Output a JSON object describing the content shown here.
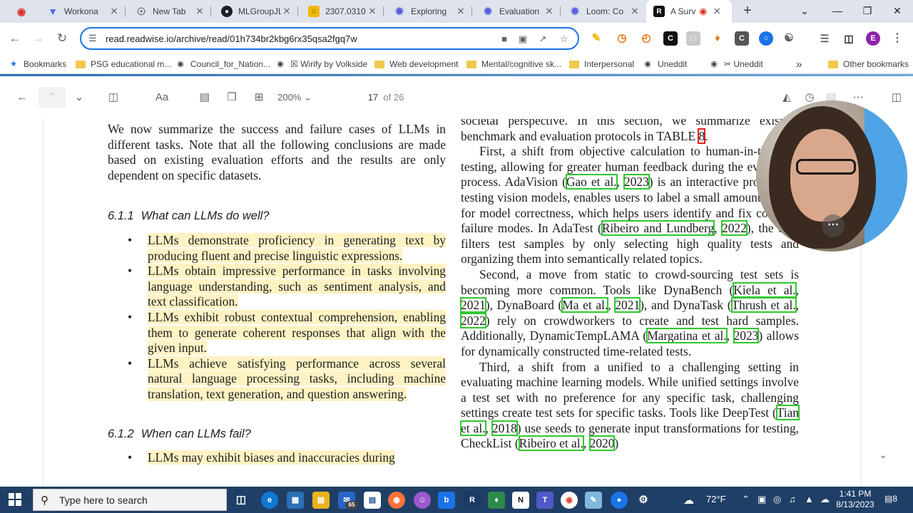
{
  "browser": {
    "tabs": [
      {
        "title": "",
        "icon": "record-icon",
        "color": "#d93025"
      },
      {
        "title": "Workona",
        "icon": "workona-icon",
        "color": "#4a6cf7"
      },
      {
        "title": "New Tab",
        "icon": "chrome-icon",
        "color": "#5f6368"
      },
      {
        "title": "MLGroupJL",
        "icon": "github-icon",
        "color": "#1b1f23"
      },
      {
        "title": "2307.0310",
        "icon": "smiley-icon",
        "color": "#f5b800"
      },
      {
        "title": "Exploring",
        "icon": "gear-icon",
        "color": "#5b5fe0"
      },
      {
        "title": "Evaluation",
        "icon": "gear-icon",
        "color": "#5b5fe0"
      },
      {
        "title": "Loom: Co",
        "icon": "loom-icon",
        "color": "#5b5fe0"
      },
      {
        "title": "A Surv",
        "icon": "readwise-icon",
        "color": "#111111"
      }
    ],
    "new_tab_label": "+",
    "url": "read.readwise.io/archive/read/01h734br2kbg6rx35qsa2fgq7w",
    "profile_initial": "E",
    "bookmarks": [
      {
        "label": "Bookmarks",
        "icon": "star"
      },
      {
        "label": "PSG educational m...",
        "icon": "folder"
      },
      {
        "label": "Council_for_Nation...",
        "icon": "globe"
      },
      {
        "label": "☒ Wirify by Volkside",
        "icon": "globe"
      },
      {
        "label": "Web development",
        "icon": "folder"
      },
      {
        "label": "Mental/cognitive sk...",
        "icon": "folder"
      },
      {
        "label": "Interpersonal",
        "icon": "folder"
      },
      {
        "label": "Uneddit",
        "icon": "globe"
      },
      {
        "label": "✂ Uneddit",
        "icon": "globe"
      }
    ],
    "bookmarks_overflow": "»",
    "other_bookmarks": "Other bookmarks"
  },
  "reader": {
    "zoom": "200%",
    "page_current": "17",
    "page_total": "of 26",
    "font_button": "Aa"
  },
  "document": {
    "left": {
      "intro": "We now summarize the success and failure cases of LLMs in different tasks. Note that all the following conclusions are made based on existing evaluation efforts and the results are only dependent on specific datasets.",
      "h1_num": "6.1.1",
      "h1_title": "What can LLMs do well?",
      "bullets": [
        "LLMs demonstrate proficiency in generating text by producing fluent and precise linguistic expressions.",
        "LLMs obtain impressive performance in tasks involving language understanding, such as sentiment analysis, and text classification.",
        "LLMs exhibit robust contextual comprehension, enabling them to generate coherent responses that align with the given input.",
        "LLMs achieve satisfying performance across several natural language processing tasks, including machine translation, text generation, and question answering."
      ],
      "h2_num": "6.1.2",
      "h2_title": "When can LLMs fail?",
      "bullet_fail": "LLMs may exhibit biases and inaccuracies during"
    },
    "right": {
      "p0_a": "societal perspective. In this section, we summarize existing benchmark and evaluation protocols in TABLE ",
      "p0_ref": "8",
      "p0_b": ".",
      "p1_a": "First, a shift from objective calculation to human-in-the-loop testing, allowing for greater human feedback during the evaluation process. AdaVision (",
      "p1_c1": "Gao et al.",
      "p1_c1y": "2023",
      "p1_b": ") is an interactive process for testing vision models, enables users to label a small amount of data for model correctness, which helps users identify and fix coherent failure modes. In AdaTest (",
      "p1_c2": "Ribeiro and Lundberg",
      "p1_c2y": "2022",
      "p1_c": "), the user filters test samples by only selecting high quality tests and organizing them into semantically related topics.",
      "p2_a": "Second, a move from static to crowd-sourcing test sets is becoming more common. Tools like DynaBench (",
      "p2_c1": "Kiela et al.",
      "p2_c1y": "2021",
      "p2_b": "), DynaBoard (",
      "p2_c2": "Ma et al.",
      "p2_c2y": "2021",
      "p2_c": "), and DynaTask (",
      "p2_c3": "Thrush et al.",
      "p2_c3y": "2022",
      "p2_d": ") rely on crowdworkers to create and test hard samples. Additionally, DynamicTempLAMA (",
      "p2_c4": "Margatina et al.",
      "p2_c4y": "2023",
      "p2_e": ") allows for dynamically constructed time-related tests.",
      "p3_a": "Third, a shift from a unified to a challenging setting in evaluating machine learning models. While unified settings involve a test set with no preference for any specific task, challenging settings create test sets for specific tasks. Tools like DeepTest (",
      "p3_c1": "Tian et al.",
      "p3_c1y": "2018",
      "p3_b": ") use seeds to generate input transformations for testing, CheckList (",
      "p3_c2": "Ribeiro et al.",
      "p3_c2y": "2020",
      "p3_c": ")"
    }
  },
  "taskbar": {
    "search_placeholder": "Type here to search",
    "badge": "65",
    "weather": "72°F",
    "time": "1:41 PM",
    "date": "8/13/2023",
    "notifications": "8"
  }
}
